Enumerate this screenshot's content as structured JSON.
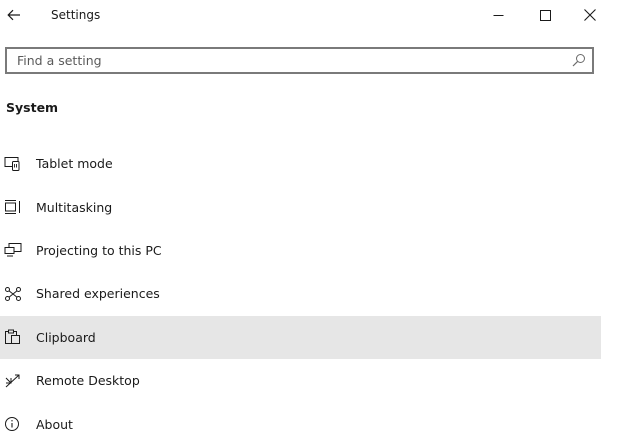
{
  "window": {
    "title": "Settings"
  },
  "search": {
    "placeholder": "Find a setting",
    "value": ""
  },
  "section": {
    "heading": "System"
  },
  "nav": {
    "items": [
      {
        "label": "Tablet mode",
        "icon": "tablet-mode-icon",
        "selected": false
      },
      {
        "label": "Multitasking",
        "icon": "multitasking-icon",
        "selected": false
      },
      {
        "label": "Projecting to this PC",
        "icon": "projecting-icon",
        "selected": false
      },
      {
        "label": "Shared experiences",
        "icon": "shared-experiences-icon",
        "selected": false
      },
      {
        "label": "Clipboard",
        "icon": "clipboard-icon",
        "selected": true
      },
      {
        "label": "Remote Desktop",
        "icon": "remote-desktop-icon",
        "selected": false
      },
      {
        "label": "About",
        "icon": "info-icon",
        "selected": false
      }
    ]
  },
  "colors": {
    "selected_background": "#e6e6e6",
    "text": "#1a1a1a",
    "search_border": "#7a7a7a"
  }
}
